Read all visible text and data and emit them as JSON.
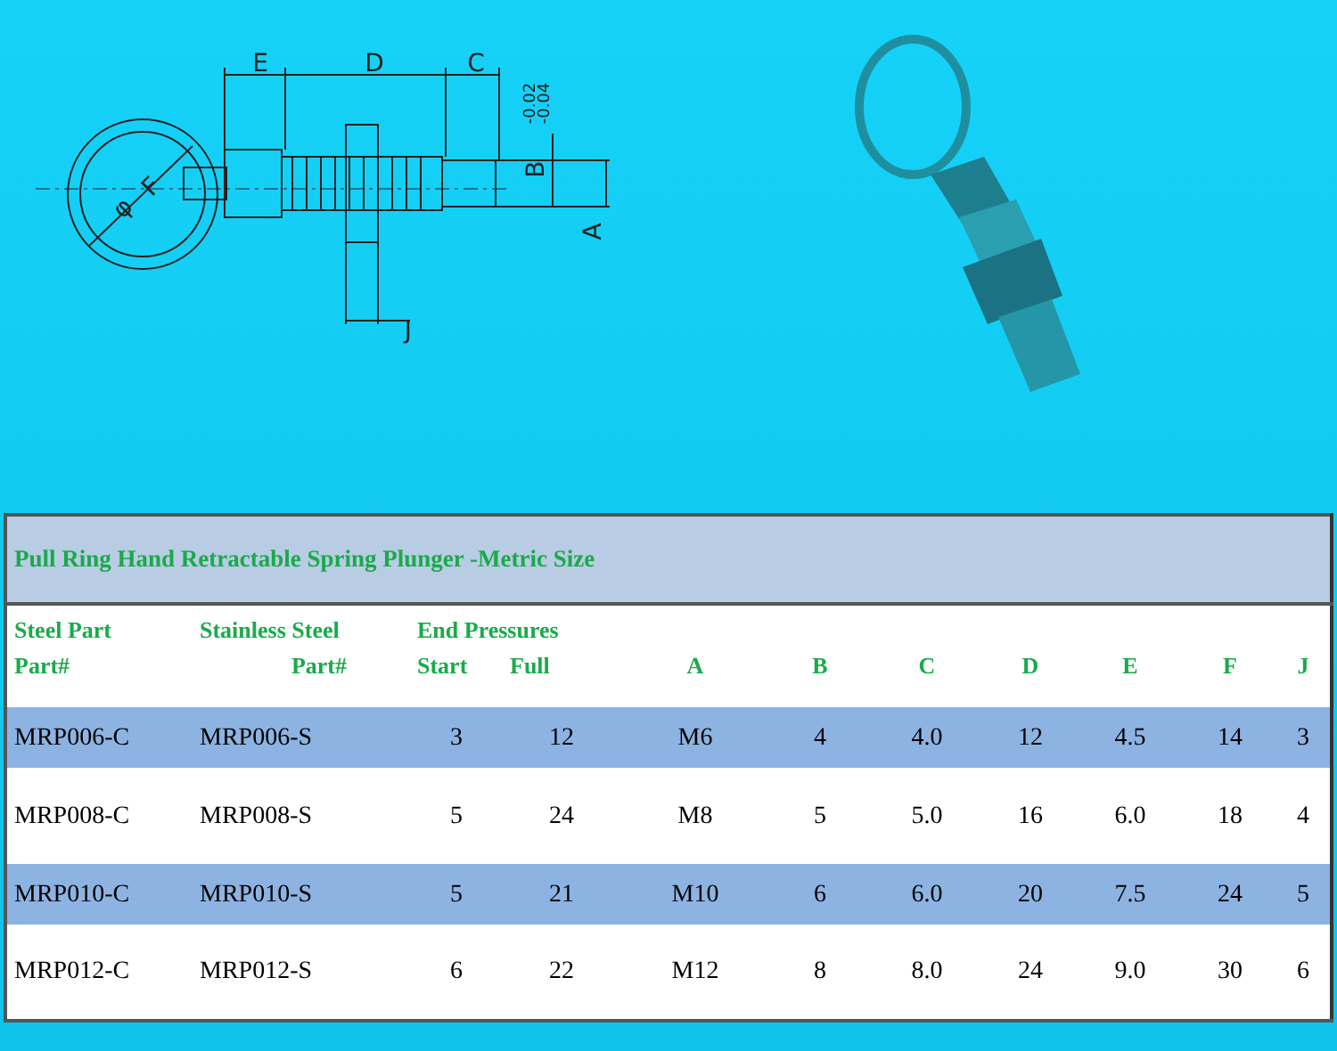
{
  "drawing": {
    "labels": [
      "E",
      "D",
      "C",
      "-0.02",
      "-0.04",
      "B",
      "A",
      "φ",
      "F",
      "J"
    ]
  },
  "table": {
    "title": "Pull Ring Hand Retractable Spring Plunger -Metric Size",
    "header_row_1": [
      "Steel Part",
      "Stainless Steel",
      "End Pressures"
    ],
    "header_row_2": [
      "Part#",
      "Part#",
      "Start",
      "Full",
      "A",
      "B",
      "C",
      "D",
      "E",
      "F",
      "J"
    ],
    "rows": [
      {
        "highlighted": true,
        "cells": [
          "MRP006-C",
          "MRP006-S",
          "3",
          "12",
          "M6",
          "4",
          "4.0",
          "12",
          "4.5",
          "14",
          "3"
        ]
      },
      {
        "highlighted": false,
        "cells": [
          "MRP008-C",
          "MRP008-S",
          "5",
          "24",
          "M8",
          "5",
          "5.0",
          "16",
          "6.0",
          "18",
          "4"
        ]
      },
      {
        "highlighted": true,
        "cells": [
          "MRP010-C",
          "MRP010-S",
          "5",
          "21",
          "M10",
          "6",
          "6.0",
          "20",
          "7.5",
          "24",
          "5"
        ]
      },
      {
        "highlighted": false,
        "cells": [
          "MRP012-C",
          "MRP012-S",
          "6",
          "22",
          "M12",
          "8",
          "8.0",
          "24",
          "9.0",
          "30",
          "6"
        ]
      }
    ]
  }
}
